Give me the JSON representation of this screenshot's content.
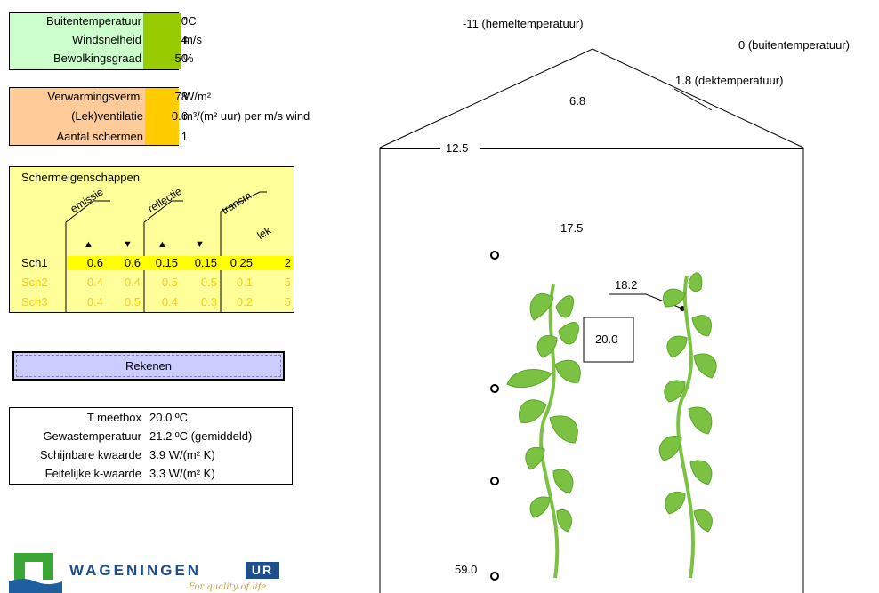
{
  "weather": {
    "rows": [
      {
        "label": "Buitentemperatuur",
        "value": "0",
        "unit": "°C"
      },
      {
        "label": "Windsnelheid",
        "value": "4",
        "unit": "m/s"
      },
      {
        "label": "Bewolkingsgraad",
        "value": "50",
        "unit": "%"
      }
    ]
  },
  "heating": {
    "rows": [
      {
        "label": "Verwarmingsverm.",
        "value": "78",
        "unit": "W/m²"
      },
      {
        "label": "(Lek)ventilatie",
        "value": "0.6",
        "unit": "m³/(m² uur) per m/s wind"
      },
      {
        "label": "Aantal schermen",
        "value": "1",
        "unit": ""
      }
    ]
  },
  "screens": {
    "title": "Schermeigenschappen",
    "headers": [
      "emissie",
      "reflectie",
      "transm",
      "lek"
    ],
    "arrows": [
      "▲",
      "▼",
      "▲",
      "▼"
    ],
    "rows": [
      {
        "name": "Sch1",
        "values": [
          "0.6",
          "0.6",
          "0.15",
          "0.15",
          "0.25",
          "2"
        ]
      },
      {
        "name": "Sch2",
        "values": [
          "0.4",
          "0.4",
          "0.5",
          "0.5",
          "0.1",
          "5"
        ]
      },
      {
        "name": "Sch3",
        "values": [
          "0.4",
          "0.5",
          "0.4",
          "0.3",
          "0.2",
          "5"
        ]
      }
    ]
  },
  "calculate_label": "Rekenen",
  "results": {
    "rows": [
      {
        "label": "T meetbox",
        "value": "20.0 ºC"
      },
      {
        "label": "Gewastemperatuur",
        "value": "21.2 ºC (gemiddeld)"
      },
      {
        "label": "Schijnbare kwaarde",
        "value": "3.9 W/(m² K)"
      },
      {
        "label": "Feitelijke k-waarde",
        "value": "3.3 W/(m² K)"
      }
    ]
  },
  "logo": {
    "name": "WAGENINGEN",
    "badge": "UR",
    "tagline": "For quality of life"
  },
  "diagram": {
    "sky_temp": "-11 (hemeltemperatuur)",
    "outside_temp": "0 (buitentemperatuur)",
    "cover_temp": "1.8 (dektemperatuur)",
    "roof_air": "6.8",
    "screen_temp": "12.5",
    "upper_air": "17.5",
    "leaf_temp": "18.2",
    "meetbox": "20.0",
    "pipe_temp": "59.0"
  },
  "colors": {
    "weather_bg": "#ccffcc",
    "weather_value": "#99cc00",
    "heating_bg": "#ffcc99",
    "heating_value": "#ffcc00",
    "screens_bg": "#ffff99",
    "sch1_row": "#ffff00",
    "inactive_text": "#ffcc00",
    "button_bg": "#ccccff",
    "plant_dark": "#6ab72c",
    "plant_light": "#9bd454"
  }
}
